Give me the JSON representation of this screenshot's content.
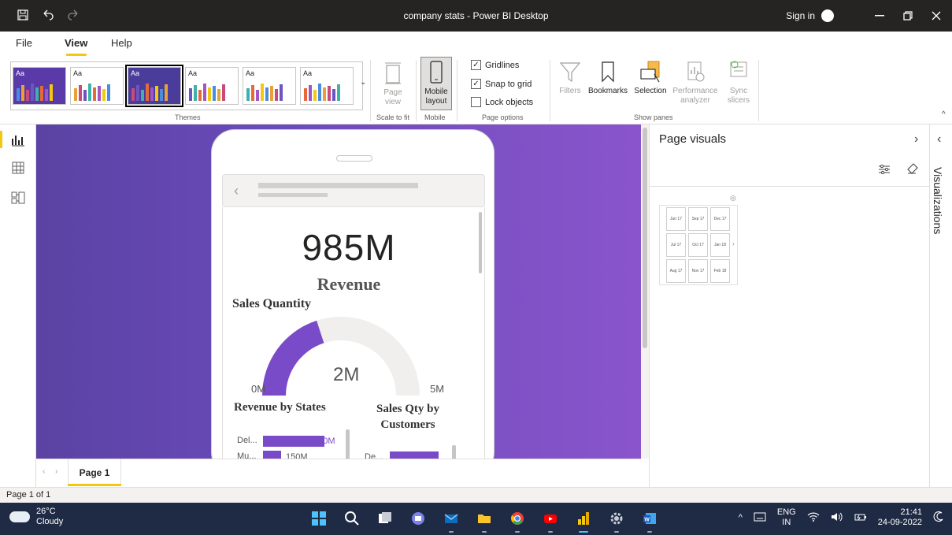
{
  "window": {
    "title": "company stats - Power BI Desktop",
    "sign_in": "Sign in"
  },
  "menu": {
    "tabs": [
      "File",
      "View",
      "Help"
    ],
    "active_tab": "View"
  },
  "ribbon": {
    "themes_label": "Themes",
    "themes": [
      {
        "aa": "Aa",
        "bg": "#5a3aa8",
        "fg": "#ffffff"
      },
      {
        "aa": "Aa",
        "bg": "#ffffff",
        "fg": "#252423"
      },
      {
        "aa": "Aa",
        "bg": "#4a3c9a",
        "fg": "#ffffff"
      },
      {
        "aa": "Aa",
        "bg": "#ffffff",
        "fg": "#252423"
      },
      {
        "aa": "Aa",
        "bg": "#ffffff",
        "fg": "#252423"
      },
      {
        "aa": "Aa",
        "bg": "#ffffff",
        "fg": "#252423"
      }
    ],
    "page_view": "Page view",
    "scale_to_fit_label": "Scale to fit",
    "mobile_layout": "Mobile layout",
    "mobile_label": "Mobile",
    "page_options_label": "Page options",
    "gridlines": {
      "label": "Gridlines",
      "checked": true
    },
    "snap_to_grid": {
      "label": "Snap to grid",
      "checked": true
    },
    "lock_objects": {
      "label": "Lock objects",
      "checked": false
    },
    "filters": "Filters",
    "bookmarks": "Bookmarks",
    "selection": "Selection",
    "performance_analyzer": "Performance analyzer",
    "sync_slicers": "Sync slicers",
    "show_panes_label": "Show panes"
  },
  "report": {
    "kpi_value": "985M",
    "kpi_label": "Revenue",
    "gauge_title": "Sales Quantity",
    "gauge_min": "0M",
    "gauge_value": "2M",
    "gauge_max": "5M",
    "gauge_fraction": 0.4,
    "revenue_by_states_title": "Revenue by States",
    "revenue_by_states": [
      {
        "label": "Del...",
        "value": "520M"
      },
      {
        "label": "Mu...",
        "value": "150M"
      }
    ],
    "sales_qty_by_customers_title": "Sales Qty by Customers",
    "sales_qty_by_customers": [
      {
        "label": "De...",
        "value": ""
      }
    ]
  },
  "right_pane": {
    "title": "Page visuals",
    "visualizations_tab": "Visualizations",
    "slicer_dates": [
      "Jun 17",
      "Sep 17",
      "Dec 17",
      "Jul 17",
      "Oct 17",
      "Jan 18",
      "Aug 17",
      "Nov 17",
      "Feb 18"
    ]
  },
  "pages": {
    "tabs": [
      "Page 1"
    ],
    "status": "Page 1 of 1"
  },
  "taskbar": {
    "temperature": "26°C",
    "weather": "Cloudy",
    "lang_line1": "ENG",
    "lang_line2": "IN",
    "time": "21:41",
    "date": "24-09-2022"
  },
  "colors": {
    "accent_yellow": "#f2c811",
    "purple_bar": "#7a4bc8",
    "canvas_bg_start": "#5a43a3",
    "canvas_bg_end": "#8a55cc"
  }
}
